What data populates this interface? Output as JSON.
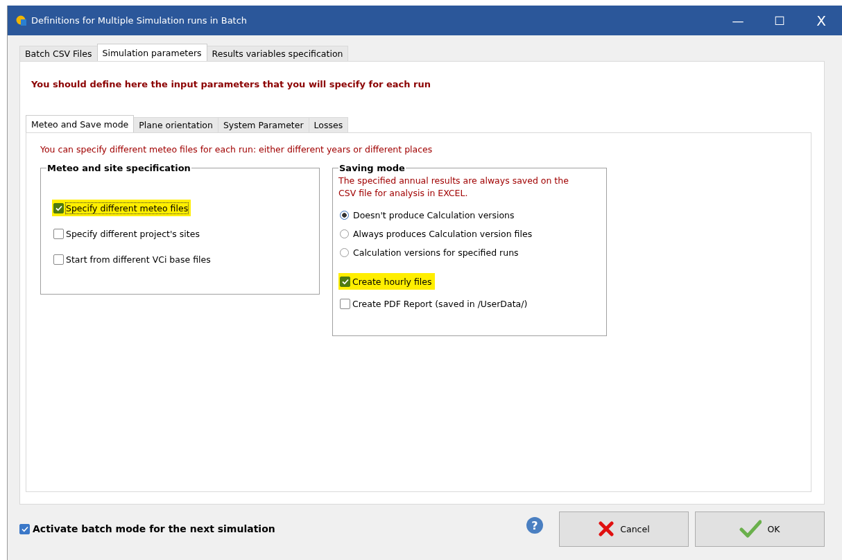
{
  "window": {
    "title": "Definitions for Multiple Simulation runs in Batch",
    "controls": [
      "—",
      "☐",
      "X"
    ]
  },
  "tabs": [
    {
      "label": "Batch CSV Files",
      "selected": false
    },
    {
      "label": "Simulation parameters",
      "selected": true
    },
    {
      "label": "Results variables specification",
      "selected": false
    }
  ],
  "intro": "You should define here the input parameters that you will specify for each run",
  "subtabs": [
    {
      "label": "Meteo and Save mode",
      "selected": true
    },
    {
      "label": "Plane orientation",
      "selected": false
    },
    {
      "label": "System Parameter",
      "selected": false
    },
    {
      "label": "Losses",
      "selected": false
    }
  ],
  "note": "You can specify different meteo files for each run: either different years or different places",
  "meteo_group": {
    "title": "Meteo and site specification",
    "options": [
      {
        "label": "Specify different meteo files",
        "checked": true,
        "highlighted": true
      },
      {
        "label": "Specify different project's sites",
        "checked": false,
        "highlighted": false
      },
      {
        "label": "Start from different VCi base files",
        "checked": false,
        "highlighted": false
      }
    ]
  },
  "saving_group": {
    "title": "Saving mode",
    "description": "The specified annual results are always saved on the CSV file for analysis in EXCEL.",
    "radios": [
      {
        "label": "Doesn't produce Calculation versions",
        "selected": true
      },
      {
        "label": "Always produces Calculation version files",
        "selected": false
      },
      {
        "label": "Calculation versions for specified runs",
        "selected": false
      }
    ],
    "options": [
      {
        "label": "Create hourly files",
        "checked": true,
        "highlighted": true
      },
      {
        "label": "Create PDF Report (saved in /UserData/)",
        "checked": false,
        "highlighted": false
      }
    ]
  },
  "batch_mode": {
    "label": "Activate batch mode for the next simulation",
    "checked": true
  },
  "help": "?",
  "buttons": [
    {
      "kind": "cancel",
      "label": "Cancel"
    },
    {
      "kind": "ok",
      "label": "OK"
    }
  ]
}
